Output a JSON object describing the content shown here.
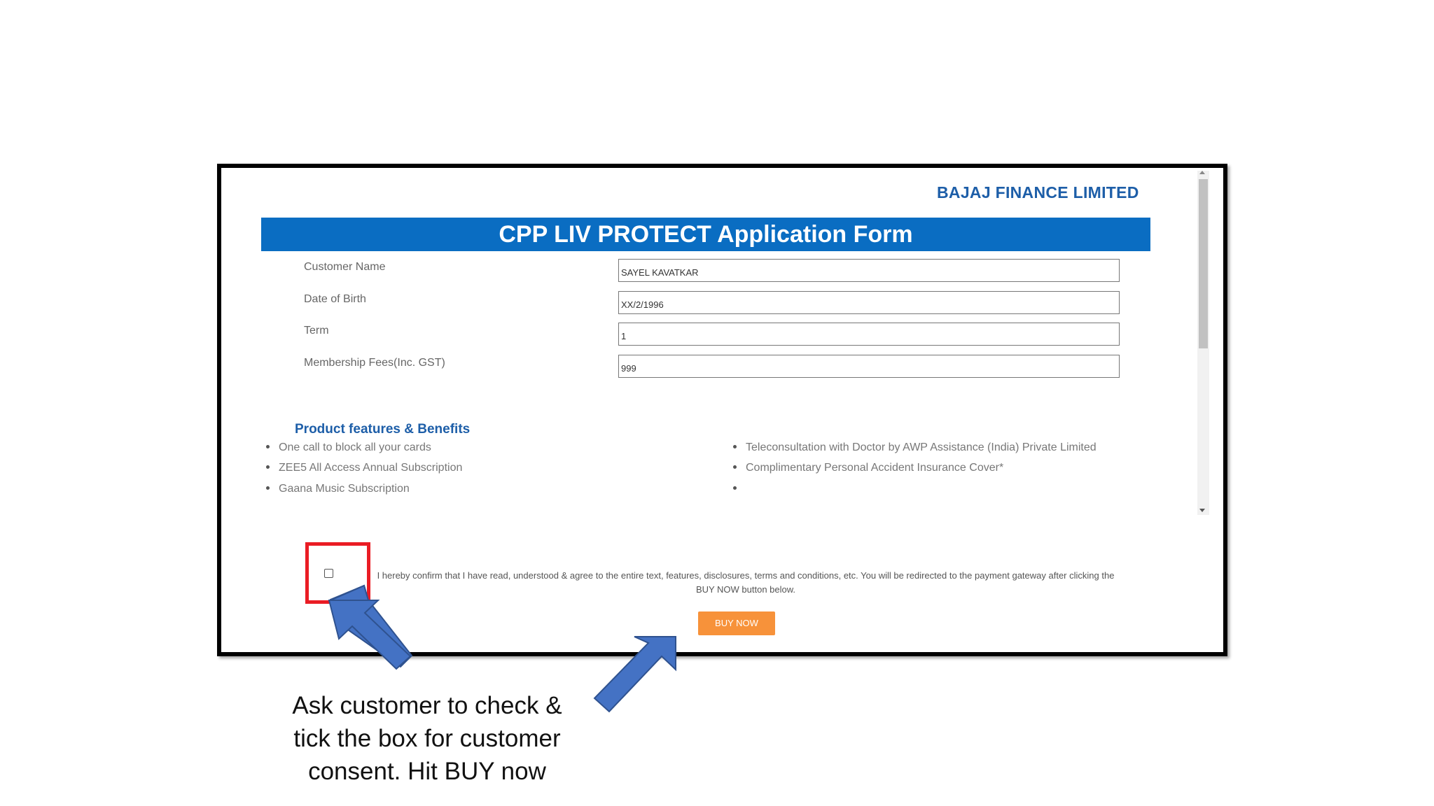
{
  "brand": "BAJAJ FINANCE LIMITED",
  "form_title": "CPP LIV PROTECT Application Form",
  "fields": [
    {
      "label": "Customer Name",
      "value": "SAYEL KAVATKAR"
    },
    {
      "label": "Date of Birth",
      "value": "XX/2/1996"
    },
    {
      "label": "Term",
      "value": "1"
    },
    {
      "label": "Membership Fees(Inc. GST)",
      "value": "999"
    }
  ],
  "features": {
    "title": "Product features & Benefits",
    "left": [
      "One call to block all your cards",
      "ZEE5 All Access Annual Subscription",
      "Gaana Music Subscription"
    ],
    "right": [
      "Teleconsultation with Doctor by AWP Assistance (India) Private Limited",
      "Complimentary Personal Accident Insurance Cover*",
      ""
    ]
  },
  "consent": {
    "checked": false,
    "line1": "I hereby confirm that I have read, understood & agree to the entire text, features, disclosures, terms and conditions, etc. You will be redirected to the payment gateway after clicking the",
    "line2": "BUY NOW button below."
  },
  "buy_button": "BUY NOW",
  "caption": [
    "Ask customer to  check &",
    "tick the box for customer",
    "consent. Hit BUY now"
  ],
  "colors": {
    "banner": "#0a6dc2",
    "brand_text": "#1d5ea8",
    "buy_button": "#f7923a",
    "highlight_box": "#ea1c24",
    "arrow": "#4472c4"
  }
}
